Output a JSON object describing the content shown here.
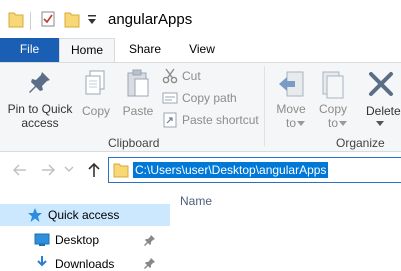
{
  "window": {
    "title": "angularApps"
  },
  "tabs": {
    "file": "File",
    "home": "Home",
    "share": "Share",
    "view": "View"
  },
  "ribbon": {
    "pin": {
      "line1": "Pin to Quick",
      "line2": "access"
    },
    "copy": "Copy",
    "paste": "Paste",
    "cut": "Cut",
    "copy_path": "Copy path",
    "paste_shortcut": "Paste shortcut",
    "clipboard_group": "Clipboard",
    "move_to": {
      "line1": "Move",
      "line2": "to"
    },
    "copy_to": {
      "line1": "Copy",
      "line2": "to"
    },
    "delete": "Delete",
    "organize_group": "Organize"
  },
  "address": {
    "path": "C:\\Users\\user\\Desktop\\angularApps"
  },
  "content": {
    "column_name": "Name"
  },
  "nav": {
    "quick_access": "Quick access",
    "desktop": "Desktop",
    "downloads": "Downloads"
  },
  "colors": {
    "accent": "#1a5fb4",
    "selection": "#0078d7",
    "quick_access_bg": "#cce8ff",
    "folder": "#f8d775"
  }
}
